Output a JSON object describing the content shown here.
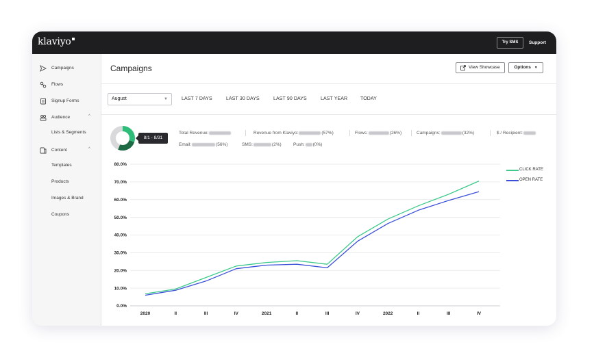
{
  "app": {
    "logo_text": "klaviyo",
    "topbar": {
      "try_sms": "Try SMS",
      "support": "Support"
    }
  },
  "sidebar": {
    "items": [
      {
        "label": "Campaigns",
        "icon": "send-icon"
      },
      {
        "label": "Flows",
        "icon": "flows-icon"
      },
      {
        "label": "Signup Forms",
        "icon": "form-icon"
      },
      {
        "label": "Audience",
        "icon": "audience-icon",
        "expanded": true
      },
      {
        "label": "Content",
        "icon": "content-icon",
        "expanded": true
      }
    ],
    "audience_children": [
      "Lists & Segments"
    ],
    "content_children": [
      "Templates",
      "Products",
      "Images & Brand",
      "Coupons"
    ]
  },
  "header": {
    "title": "Campaigns",
    "view_showcase": "View Showcase",
    "options": "Options"
  },
  "filters": {
    "month_select": "August",
    "ranges": [
      "LAST 7 DAYS",
      "LAST 30 DAYS",
      "LAST 90 DAYS",
      "LAST YEAR",
      "TODAY"
    ]
  },
  "summary": {
    "date_range": "8/1 - 8/31",
    "donut_fraction": 0.56,
    "colors": {
      "green": "#2ebd79",
      "dark_green": "#1d6b44",
      "gray": "#d9d9dc"
    },
    "row1": [
      {
        "label": "Total Revenue:",
        "suffix": ""
      },
      {
        "label": "Revenue from Klaviyo:",
        "suffix": "(57%)"
      },
      {
        "label": "Flows:",
        "suffix": "(26%)"
      },
      {
        "label": "Campaigns:",
        "suffix": "(32%)"
      },
      {
        "label": "$ / Recipient:",
        "suffix": ""
      }
    ],
    "row2": [
      {
        "label": "Email:",
        "suffix": "(56%)"
      },
      {
        "label": "SMS:",
        "suffix": "(2%)"
      },
      {
        "label": "Push:",
        "suffix": "(0%)"
      }
    ]
  },
  "chart_data": {
    "type": "line",
    "categories": [
      "2020",
      "II",
      "III",
      "IV",
      "2021",
      "II",
      "III",
      "IV",
      "2022",
      "II",
      "III",
      "IV"
    ],
    "series": [
      {
        "name": "CLICK RATE",
        "color": "#3cc98b",
        "values": [
          6.8,
          9.5,
          16.0,
          22.5,
          24.5,
          25.5,
          23.5,
          39.0,
          49.0,
          56.5,
          63.0,
          70.5
        ]
      },
      {
        "name": "OPEN RATE",
        "color": "#3a4fd8",
        "values": [
          6.0,
          8.8,
          14.0,
          21.0,
          23.0,
          23.5,
          21.5,
          36.5,
          46.5,
          54.0,
          59.5,
          64.5
        ]
      }
    ],
    "yticks": [
      "80.0%",
      "70.0%",
      "60.0%",
      "50.0%",
      "40.0%",
      "30.0%",
      "20.0%",
      "10.0%",
      "0.0%"
    ],
    "ylim": [
      0,
      80
    ],
    "grid": true,
    "legend_position": "right"
  }
}
